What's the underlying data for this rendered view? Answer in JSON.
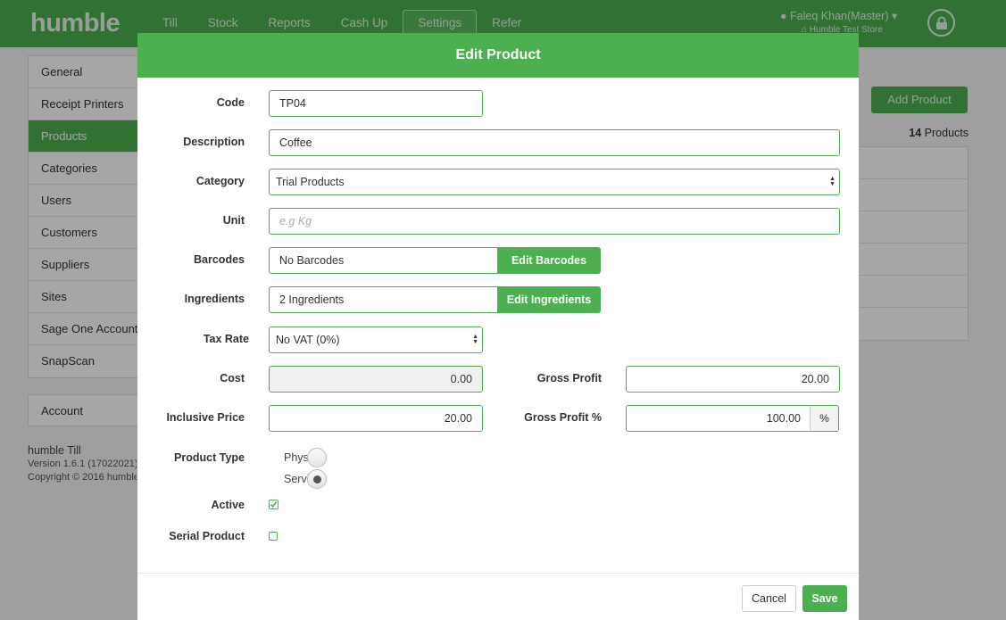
{
  "app": {
    "logo": "humble"
  },
  "nav": {
    "items": [
      "Till",
      "Stock",
      "Reports",
      "Cash Up",
      "Settings",
      "Refer"
    ],
    "active": "Settings"
  },
  "user": {
    "name": "Faleq Khan(Master)",
    "store": "Humble Test Store"
  },
  "sidebar": {
    "items": [
      "General",
      "Receipt Printers",
      "Products",
      "Categories",
      "Users",
      "Customers",
      "Suppliers",
      "Sites",
      "Sage One Accounting",
      "SnapScan"
    ],
    "active": "Products",
    "account": "Account"
  },
  "footer_info": {
    "app": "humble Till",
    "version": "Version 1.6.1 (17022021)",
    "copyright": "Copyright © 2016 humble"
  },
  "products_page": {
    "add_button": "Add Product",
    "count": "14",
    "count_label": " Products"
  },
  "modal": {
    "title": "Edit Product",
    "code": {
      "label": "Code",
      "value": "TP04"
    },
    "description": {
      "label": "Description",
      "value": "Coffee"
    },
    "category": {
      "label": "Category",
      "value": "Trial Products"
    },
    "unit": {
      "label": "Unit",
      "value": "",
      "placeholder": "e.g Kg"
    },
    "barcodes": {
      "label": "Barcodes",
      "value": "No Barcodes",
      "button": "Edit Barcodes"
    },
    "ingredients": {
      "label": "Ingredients",
      "value": "2 Ingredients",
      "button": "Edit Ingredients"
    },
    "tax_rate": {
      "label": "Tax Rate",
      "value": "No VAT (0%)"
    },
    "cost": {
      "label": "Cost",
      "value": "0.00"
    },
    "gross_profit": {
      "label": "Gross Profit",
      "value": "20.00"
    },
    "inclusive_price": {
      "label": "Inclusive Price",
      "value": "20.00"
    },
    "gross_profit_pct": {
      "label": "Gross Profit %",
      "value": "100.00",
      "unit": "%"
    },
    "product_type": {
      "label": "Product Type",
      "options": [
        "Phys",
        "Servi"
      ],
      "selected": "Servi"
    },
    "active": {
      "label": "Active",
      "checked": true
    },
    "serial": {
      "label": "Serial Product",
      "checked": false
    },
    "cancel": "Cancel",
    "save": "Save"
  }
}
